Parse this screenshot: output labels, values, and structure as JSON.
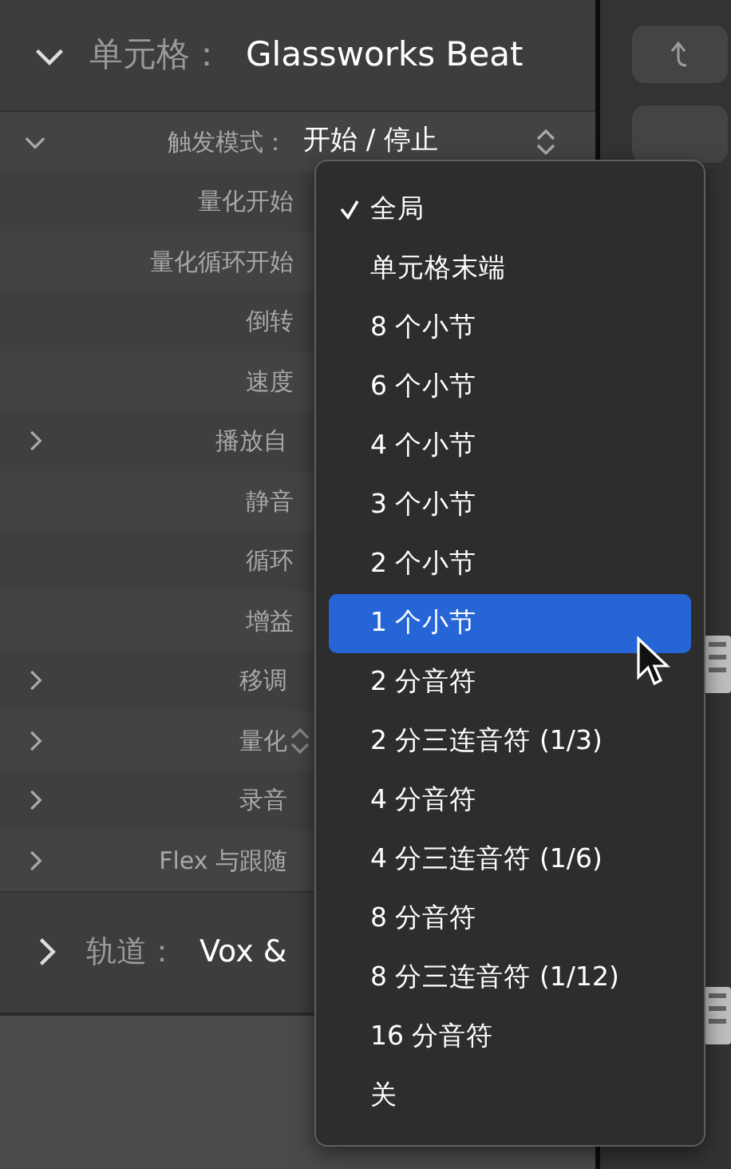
{
  "cell_section": {
    "expanded": true,
    "label": "单元格：",
    "name": "Glassworks Beat"
  },
  "rows": [
    {
      "label": "触发模式：",
      "expanded": true,
      "value": "开始 / 停止",
      "kind": "popup"
    },
    {
      "label": "量化开始"
    },
    {
      "label": "量化循环开始"
    },
    {
      "label": "倒转"
    },
    {
      "label": "速度"
    },
    {
      "label": "播放自",
      "expanded": false
    },
    {
      "label": "静音"
    },
    {
      "label": "循环"
    },
    {
      "label": "增益"
    },
    {
      "label": "移调",
      "expanded": false
    },
    {
      "label": "量化",
      "expanded": false,
      "kind": "stepper"
    },
    {
      "label": "录音",
      "expanded": false
    },
    {
      "label": "Flex 与跟随",
      "expanded": false
    }
  ],
  "track_section": {
    "expanded": false,
    "label": "轨道：",
    "name": "Vox &"
  },
  "menu": [
    {
      "label": "全局",
      "checked": true,
      "selected": false
    },
    {
      "label": "单元格末端",
      "checked": false,
      "selected": false
    },
    {
      "label": "8 个小节",
      "checked": false,
      "selected": false
    },
    {
      "label": "6 个小节",
      "checked": false,
      "selected": false
    },
    {
      "label": "4 个小节",
      "checked": false,
      "selected": false
    },
    {
      "label": "3 个小节",
      "checked": false,
      "selected": false
    },
    {
      "label": "2 个小节",
      "checked": false,
      "selected": false
    },
    {
      "label": "1 个小节",
      "checked": false,
      "selected": true
    },
    {
      "label": "2 分音符",
      "checked": false,
      "selected": false
    },
    {
      "label": "2 分三连音符 (1/3)",
      "checked": false,
      "selected": false
    },
    {
      "label": "4 分音符",
      "checked": false,
      "selected": false
    },
    {
      "label": "4 分三连音符 (1/6)",
      "checked": false,
      "selected": false
    },
    {
      "label": "8 分音符",
      "checked": false,
      "selected": false
    },
    {
      "label": "8 分三连音符 (1/12)",
      "checked": false,
      "selected": false
    },
    {
      "label": "16 分音符",
      "checked": false,
      "selected": false
    },
    {
      "label": "关",
      "checked": false,
      "selected": false
    }
  ]
}
